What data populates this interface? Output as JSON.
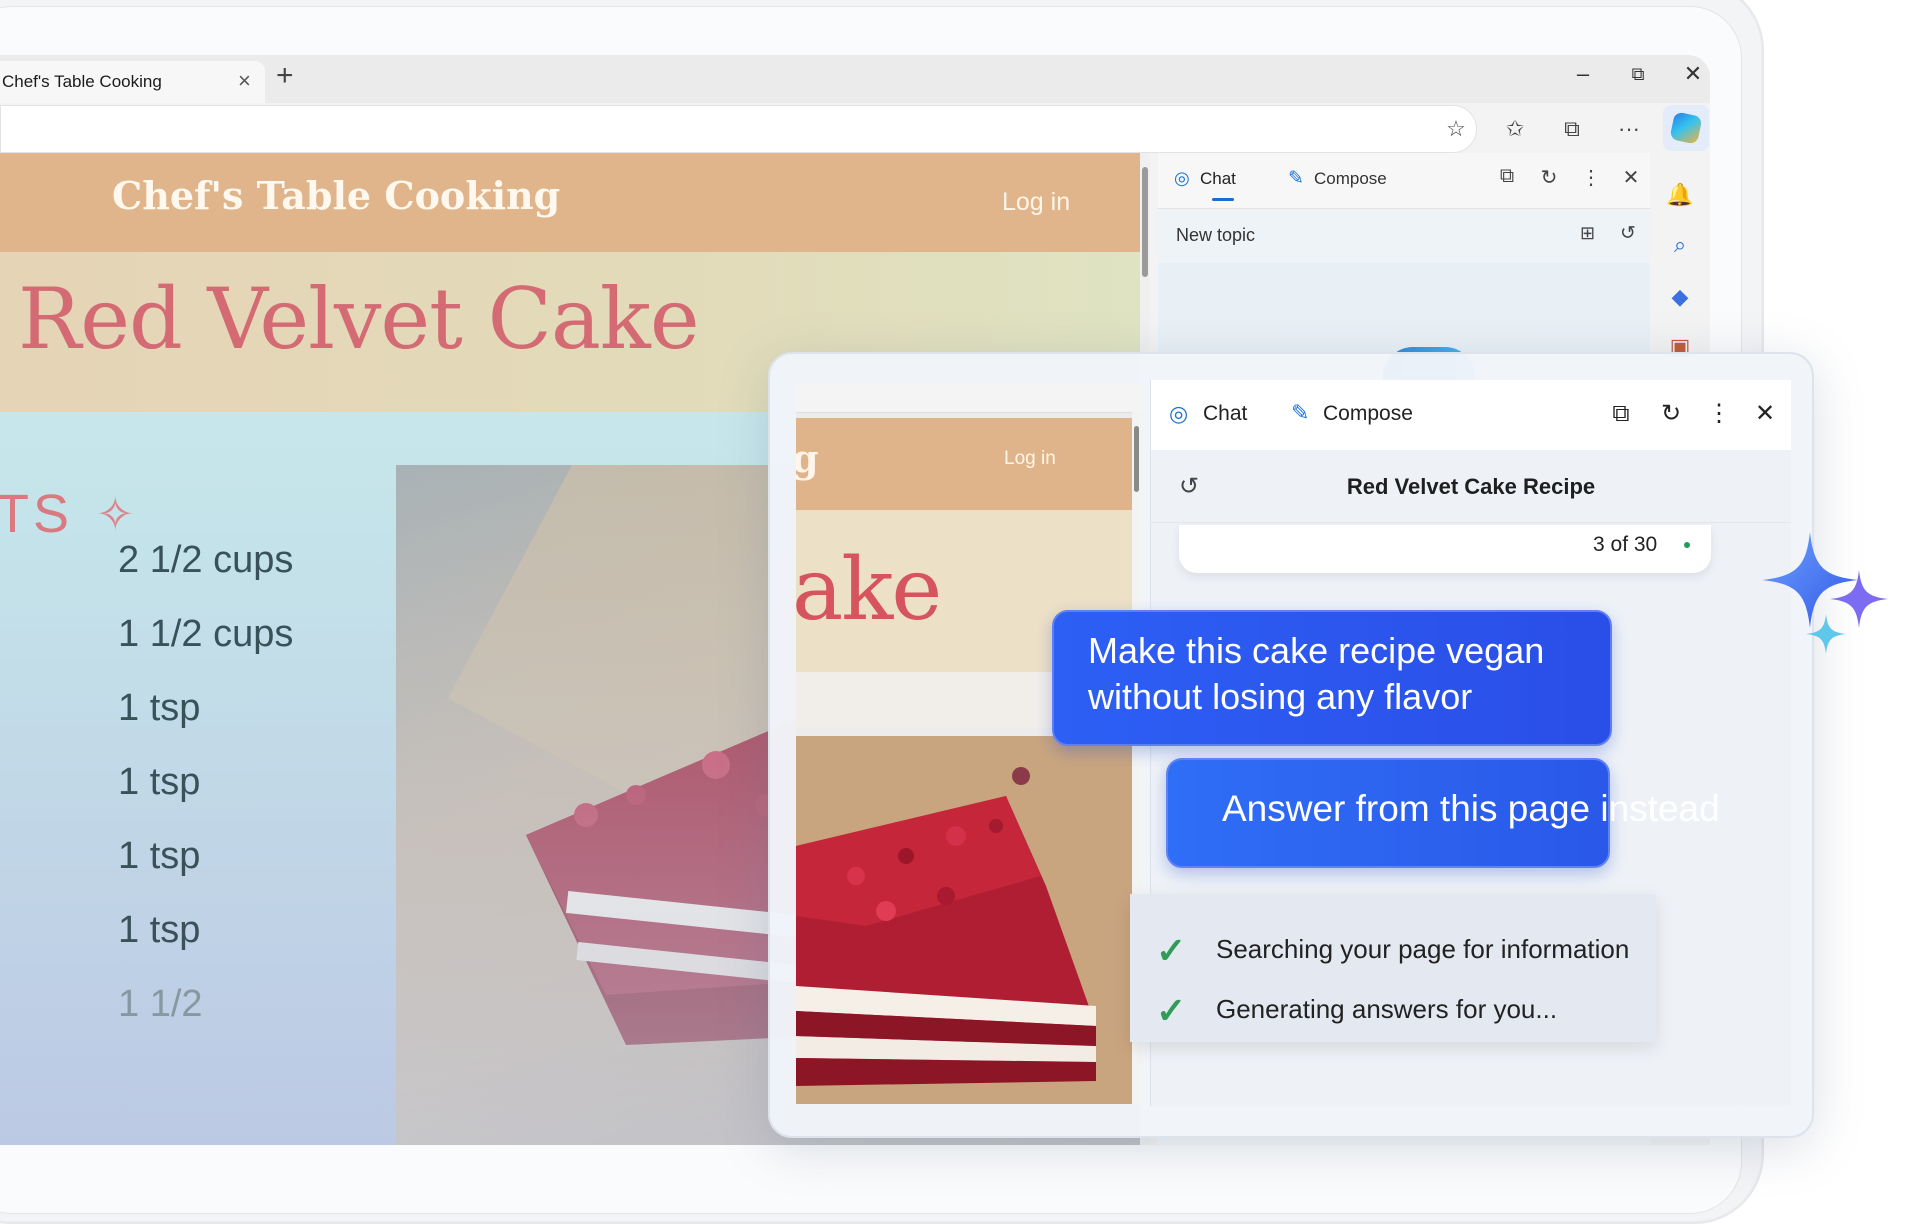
{
  "browser": {
    "tab_title": "Chef's Table Cooking",
    "tab_close": "×",
    "new_tab": "+",
    "window_controls": {
      "minimize": "–",
      "restore": "⧉",
      "close": "✕"
    },
    "toolbar_icons": [
      "star-add-icon",
      "favorites-icon",
      "collections-icon",
      "more-icon",
      "copilot-icon"
    ],
    "more": "···"
  },
  "page": {
    "site_title": "Chef's Table Cooking",
    "login": "Log in",
    "recipe_title": "Red Velvet Cake",
    "section_heading": "TS",
    "ingredients": [
      "2 1/2 cups",
      "1 1/2 cups",
      "1 tsp",
      "1 tsp",
      "1 tsp",
      "1 tsp",
      "1 1/2"
    ]
  },
  "sidebar": {
    "chat_label": "Chat",
    "compose_label": "Compose",
    "topic": "New topic",
    "rail_icons": [
      "bell-icon",
      "search-icon",
      "tag-icon",
      "briefcase-icon"
    ]
  },
  "overlay": {
    "page_fragment_title": "g",
    "page_login": "Log in",
    "page_fragment_hero": "ake",
    "chat_label": "Chat",
    "compose_label": "Compose",
    "conversation_title": "Red Velvet Cake Recipe",
    "counter": "3 of 30",
    "user_prompt": "Make this cake recipe vegan without losing any flavor",
    "action_button": "Answer from this page instead",
    "status_steps": [
      "Searching your page for information",
      "Generating answers for you..."
    ]
  },
  "colors": {
    "accent_blue": "#2d5ff5",
    "check_green": "#2f9d58",
    "header_tan": "#e1b58b",
    "title_rose": "#d46a73"
  }
}
